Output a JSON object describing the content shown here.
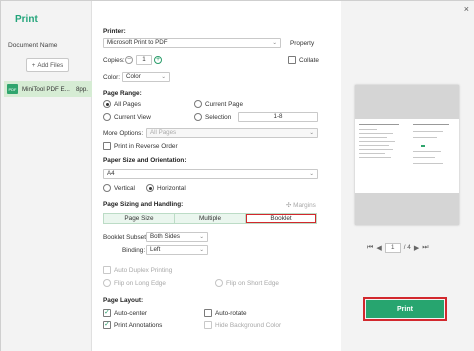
{
  "app": {
    "title": "Print",
    "close": "×"
  },
  "left": {
    "doc_header": "Document Name",
    "add_files": "Add Files",
    "add_icon": "+",
    "pdf_icon": "PDF",
    "doc": {
      "name": "MiniTool PDF E...",
      "pages": "8pp."
    }
  },
  "printer": {
    "label": "Printer:",
    "selected": "Microsoft Print to PDF",
    "property": "Property",
    "copies_label": "Copies:",
    "copies_value": "1",
    "minus": "−",
    "plus": "+",
    "collate": "Collate",
    "collate_checked": false,
    "color_label": "Color:",
    "color_value": "Color"
  },
  "page_range": {
    "label": "Page Range:",
    "all_pages": "All Pages",
    "current_page": "Current Page",
    "current_view": "Current View",
    "selection": "Selection",
    "selection_value": "1-8",
    "selected_option": "All Pages",
    "more_options_label": "More Options:",
    "more_options_value": "All Pages",
    "reverse_order": "Print in Reverse Order",
    "reverse_checked": false
  },
  "paper": {
    "label": "Paper Size and Orientation:",
    "size": "A4",
    "vertical": "Vertical",
    "horizontal": "Horizontal",
    "orientation": "Horizontal"
  },
  "sizing": {
    "label": "Page Sizing and Handling:",
    "margins": "Margins",
    "tabs": [
      "Page Size",
      "Multiple",
      "Booklet"
    ],
    "active_tab": "Booklet",
    "subset_label": "Booklet Subset:",
    "subset_value": "Both Sides",
    "binding_label": "Binding:",
    "binding_value": "Left",
    "auto_duplex": "Auto Duplex Printing",
    "flip_long": "Flip on Long Edge",
    "flip_short": "Flip on Short Edge"
  },
  "layout": {
    "label": "Page Layout:",
    "auto_center": "Auto-center",
    "auto_center_checked": true,
    "auto_rotate": "Auto-rotate",
    "auto_rotate_checked": false,
    "print_annotations": "Print Annotations",
    "print_annotations_checked": true,
    "hide_bg": "Hide Background Color",
    "hide_bg_checked": false
  },
  "preview": {
    "first": "⏮",
    "prev": "◀",
    "page": "1",
    "total": "/ 4",
    "next": "▶",
    "last": "⏭"
  },
  "actions": {
    "print": "Print"
  },
  "colors": {
    "accent": "#27a56f",
    "highlight": "#d2282d",
    "selected_doc": "#d6ecd4"
  },
  "caret": "⌄",
  "check": "✓"
}
